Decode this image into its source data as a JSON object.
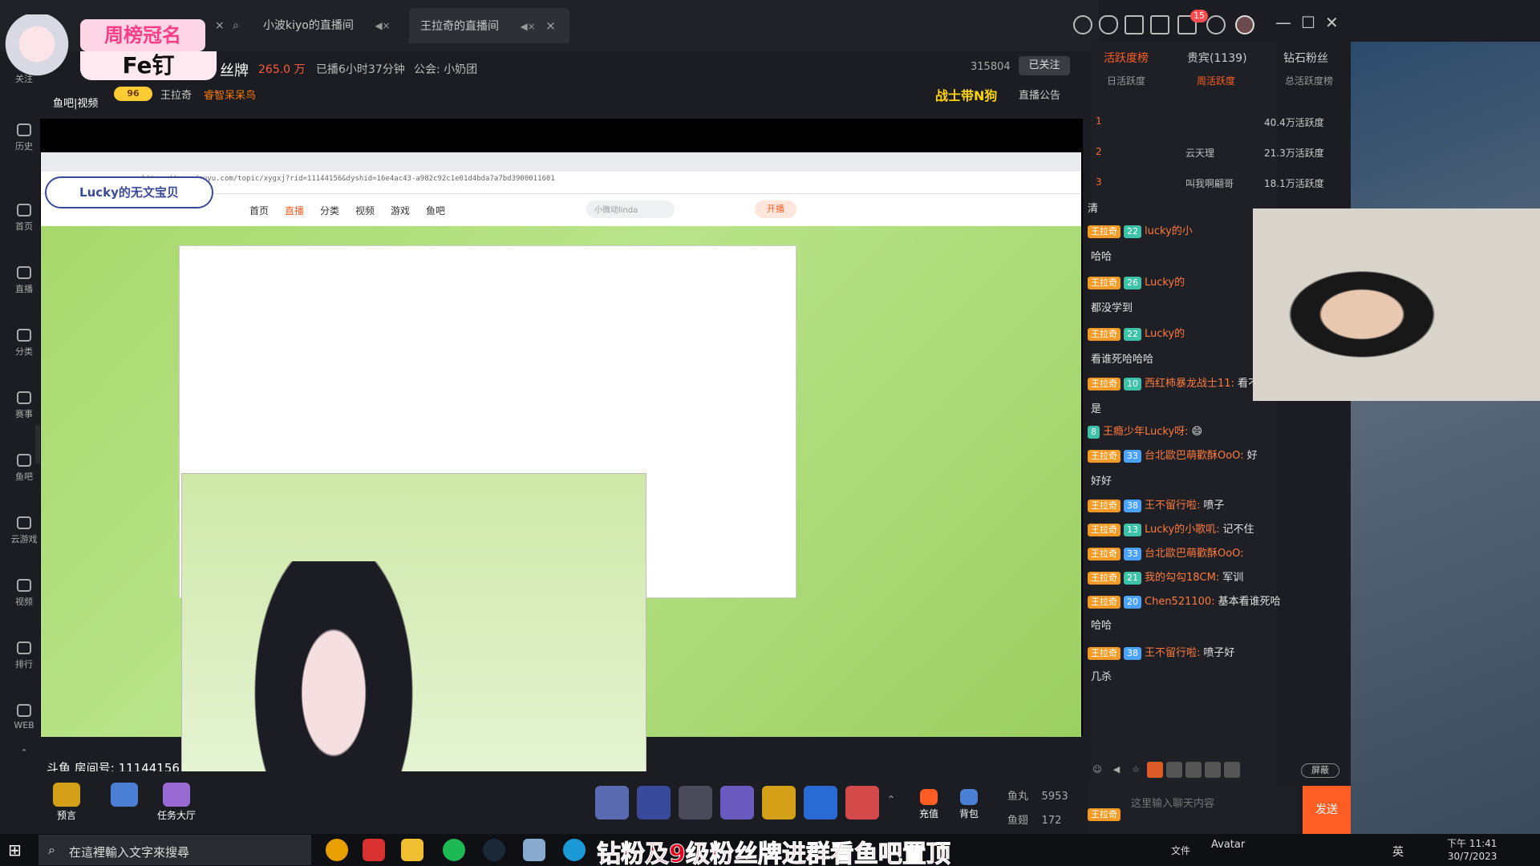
{
  "tabs": [
    {
      "label": "小波kiyo的直播间"
    },
    {
      "label": "王拉奇的直播间",
      "active": true
    }
  ],
  "header": {
    "badge_title": "周榜冠名",
    "badge_name": "Fe钉",
    "fan_brand": "丝牌",
    "heat": "265.0 万",
    "duration": "已播6小时37分钟",
    "guild": "公会: 小奶团",
    "room_id": "315804",
    "followed": "已关注",
    "level": "96",
    "host": "王拉奇",
    "fan_title": "睿智呆呆鸟",
    "section_label": "鱼吧|视频",
    "warrior": "战士带N狗",
    "notice": "直播公告"
  },
  "notifications": "15",
  "sidebar": [
    {
      "label": "关注"
    },
    {
      "label": "历史"
    },
    {
      "label": "首页"
    },
    {
      "label": "直播"
    },
    {
      "label": "分类"
    },
    {
      "label": "赛事"
    },
    {
      "label": "鱼吧"
    },
    {
      "label": "云游戏"
    },
    {
      "label": "视频"
    },
    {
      "label": "排行"
    },
    {
      "label": "WEB"
    }
  ],
  "browser": {
    "url": "https://www.douyu.com/topic/xygxj?rid=11144156&dyshid=16e4ac43-a982c92c1e01d4bda7a7bd3900011601",
    "nav": [
      "首页",
      "直播",
      "分类",
      "视频",
      "游戏",
      "鱼吧"
    ],
    "search_placeholder": "小微动linda",
    "open_live": "开播",
    "lucky_banner": "Lucky的无文宝贝"
  },
  "stream": {
    "room_number": "斗鱼 房间号: 11144156"
  },
  "gifts": {
    "buttons": [
      "预言",
      "任务大厅"
    ],
    "recharge": "充值",
    "backpack": "背包",
    "fish_pills_label": "鱼丸",
    "fish_pills": "5953",
    "fish_fins_label": "鱼翅",
    "fish_fins": "172"
  },
  "chat": {
    "tabs": [
      "活跃度榜",
      "贵宾(1139)",
      "钻石粉丝"
    ],
    "subtabs": [
      "日活跃度",
      "周活跃度",
      "总活跃度榜"
    ],
    "ranks": [
      {
        "n": "1",
        "name": "",
        "val": "40.4万活跃度"
      },
      {
        "n": "2",
        "name": "云天理",
        "val": "21.3万活跃度"
      },
      {
        "n": "3",
        "name": "叫我啊翩哥",
        "val": "18.1万活跃度"
      }
    ],
    "messages": [
      {
        "tag": "王拉奇",
        "lv": "22",
        "user": "lucky的小",
        "text": ""
      },
      {
        "tag": "",
        "lv": "",
        "user": "",
        "text": "哈哈"
      },
      {
        "tag": "王拉奇",
        "lv": "26",
        "user": "Lucky的",
        "text": ""
      },
      {
        "tag": "",
        "lv": "",
        "user": "",
        "text": "都没学到"
      },
      {
        "tag": "王拉奇",
        "lv": "22",
        "user": "Lucky的",
        "text": ""
      },
      {
        "tag": "",
        "lv": "",
        "user": "",
        "text": "看谁死哈哈哈"
      },
      {
        "tag": "王拉奇",
        "lv": "10",
        "user": "西红柿暴龙战士11:",
        "text": "看不清说"
      },
      {
        "tag": "",
        "lv": "",
        "user": "",
        "text": "是"
      },
      {
        "tag": "",
        "lv": "8",
        "user": "王瘾少年Lucky呀:",
        "text": "😄"
      },
      {
        "tag": "王拉奇",
        "lv": "33",
        "user": "台北歐巴萌歡酥OoO:",
        "text": "好"
      },
      {
        "tag": "",
        "lv": "",
        "user": "",
        "text": "好好"
      },
      {
        "tag": "王拉奇",
        "lv": "38",
        "user": "王不留行啦:",
        "text": "喷子"
      },
      {
        "tag": "王拉奇",
        "lv": "13",
        "user": "Lucky的小歌叽:",
        "text": "记不住"
      },
      {
        "tag": "王拉奇",
        "lv": "33",
        "user": "台北歐巴萌歡酥OoO:",
        "text": ""
      },
      {
        "tag": "王拉奇",
        "lv": "21",
        "user": "我的勾勾18CM:",
        "text": "军训"
      },
      {
        "tag": "王拉奇",
        "lv": "20",
        "user": "Chen521100:",
        "text": "基本看谁死哈"
      },
      {
        "tag": "",
        "lv": "",
        "user": "",
        "text": "哈哈"
      },
      {
        "tag": "王拉奇",
        "lv": "38",
        "user": "王不留行啦:",
        "text": "喷子好"
      },
      {
        "tag": "",
        "lv": "",
        "user": "",
        "text": "几杀"
      }
    ],
    "top_partial": "清",
    "shield": "屏蔽",
    "input_placeholder": "这里输入聊天内容",
    "send": "发送",
    "input_user": "王拉奇"
  },
  "taskbar": {
    "search": "在這裡輸入文字來搜尋",
    "overlay": "钻粉及9级粉丝牌进群看鱼吧置顶",
    "file": "文件",
    "avatar": "Avatar",
    "lang": "英",
    "time": "下午 11:41",
    "date": "30/7/2023"
  },
  "colors": {
    "accent": "#ff5d23",
    "chat_name": "#ff7a3c",
    "tag_wlq": "#f59a23"
  }
}
